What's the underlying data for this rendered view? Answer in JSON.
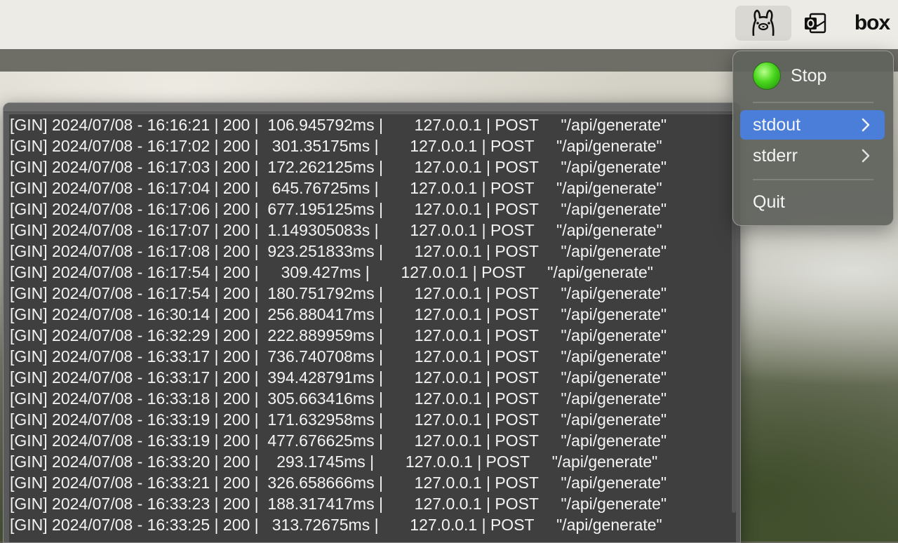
{
  "menubar": {
    "icons": [
      {
        "name": "ollama-icon"
      },
      {
        "name": "outlook-icon"
      },
      {
        "name": "box-icon",
        "text": "box"
      }
    ]
  },
  "menu": {
    "status_label": "Stop",
    "status_color": "#3ad41a",
    "items": [
      {
        "label": "stdout",
        "has_submenu": true,
        "highlighted": true
      },
      {
        "label": "stderr",
        "has_submenu": true,
        "highlighted": false
      }
    ],
    "quit_label": "Quit",
    "highlight_color": "#4a7ed8"
  },
  "log": {
    "lines": [
      "[GIN] 2024/07/08 - 16:16:21 | 200 |  106.945792ms |       127.0.0.1 | POST     \"/api/generate\"",
      "[GIN] 2024/07/08 - 16:17:02 | 200 |   301.35175ms |       127.0.0.1 | POST     \"/api/generate\"",
      "[GIN] 2024/07/08 - 16:17:03 | 200 |  172.262125ms |       127.0.0.1 | POST     \"/api/generate\"",
      "[GIN] 2024/07/08 - 16:17:04 | 200 |   645.76725ms |       127.0.0.1 | POST     \"/api/generate\"",
      "[GIN] 2024/07/08 - 16:17:06 | 200 |  677.195125ms |       127.0.0.1 | POST     \"/api/generate\"",
      "[GIN] 2024/07/08 - 16:17:07 | 200 |  1.149305083s |       127.0.0.1 | POST     \"/api/generate\"",
      "[GIN] 2024/07/08 - 16:17:08 | 200 |  923.251833ms |       127.0.0.1 | POST     \"/api/generate\"",
      "[GIN] 2024/07/08 - 16:17:54 | 200 |     309.427ms |       127.0.0.1 | POST     \"/api/generate\"",
      "[GIN] 2024/07/08 - 16:17:54 | 200 |  180.751792ms |       127.0.0.1 | POST     \"/api/generate\"",
      "[GIN] 2024/07/08 - 16:30:14 | 200 |  256.880417ms |       127.0.0.1 | POST     \"/api/generate\"",
      "[GIN] 2024/07/08 - 16:32:29 | 200 |  222.889959ms |       127.0.0.1 | POST     \"/api/generate\"",
      "[GIN] 2024/07/08 - 16:33:17 | 200 |  736.740708ms |       127.0.0.1 | POST     \"/api/generate\"",
      "[GIN] 2024/07/08 - 16:33:17 | 200 |  394.428791ms |       127.0.0.1 | POST     \"/api/generate\"",
      "[GIN] 2024/07/08 - 16:33:18 | 200 |  305.663416ms |       127.0.0.1 | POST     \"/api/generate\"",
      "[GIN] 2024/07/08 - 16:33:19 | 200 |  171.632958ms |       127.0.0.1 | POST     \"/api/generate\"",
      "[GIN] 2024/07/08 - 16:33:19 | 200 |  477.676625ms |       127.0.0.1 | POST     \"/api/generate\"",
      "[GIN] 2024/07/08 - 16:33:20 | 200 |    293.1745ms |       127.0.0.1 | POST     \"/api/generate\"",
      "[GIN] 2024/07/08 - 16:33:21 | 200 |  326.658666ms |       127.0.0.1 | POST     \"/api/generate\"",
      "[GIN] 2024/07/08 - 16:33:23 | 200 |  188.317417ms |       127.0.0.1 | POST     \"/api/generate\"",
      "[GIN] 2024/07/08 - 16:33:25 | 200 |   313.72675ms |       127.0.0.1 | POST     \"/api/generate\""
    ]
  }
}
